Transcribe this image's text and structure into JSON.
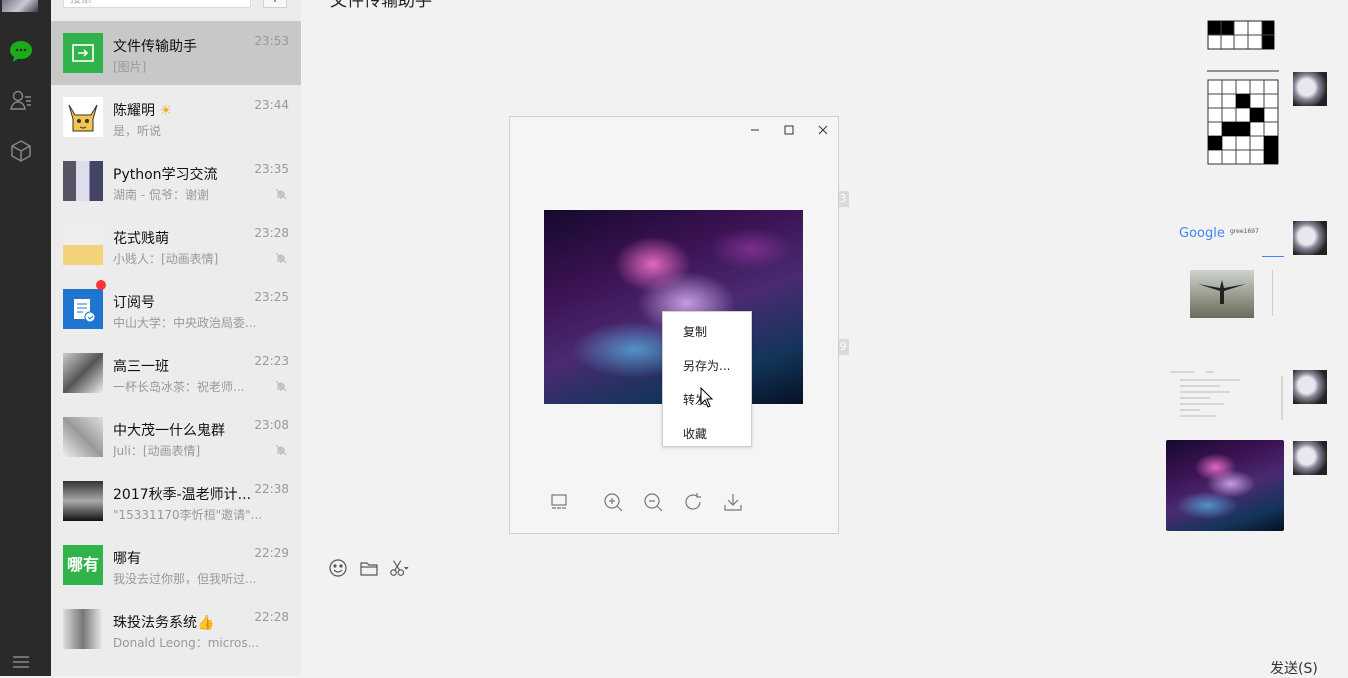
{
  "window": {
    "title": "文件传输助手"
  },
  "search": {
    "placeholder": "搜索"
  },
  "chats": [
    {
      "name": "文件传输助手",
      "time": "23:53",
      "message": "[图片]",
      "muted": false,
      "active": true
    },
    {
      "name": "陈耀明",
      "time": "23:44",
      "message": "是，听说",
      "muted": false
    },
    {
      "name": "Python学习交流",
      "time": "23:35",
      "message": "湖南 - 侃爷：谢谢",
      "muted": true
    },
    {
      "name": "花式贱萌",
      "time": "23:28",
      "message": "小贱人：[动画表情]",
      "muted": true
    },
    {
      "name": "订阅号",
      "time": "23:25",
      "message": "中山大学：中央政治局委...",
      "muted": false,
      "badge": true
    },
    {
      "name": "高三一班",
      "time": "22:23",
      "message": "一杯长岛冰茶：祝老师...",
      "muted": true
    },
    {
      "name": "中大茂一什么鬼群",
      "time": "23:08",
      "message": "Juli：[动画表情]",
      "muted": true
    },
    {
      "name": "2017秋季-温老师计...",
      "time": "22:38",
      "message": "\"15331170李忻桓\"邀请\"...",
      "muted": false
    },
    {
      "name": "哪有",
      "time": "22:29",
      "message": "我没去过你那，但我听过...",
      "muted": false
    },
    {
      "name": "珠投法务系统",
      "time": "22:28",
      "message": "Donald Leong：micros...",
      "muted": false
    }
  ],
  "icons": {
    "avatar_wenhao": "哪有"
  },
  "context_menu": [
    "复制",
    "另存为...",
    "转发",
    "收藏"
  ],
  "timestamps": [
    "3",
    "9"
  ],
  "send_button": "发送(S)",
  "google_thumb": {
    "logo": "Google",
    "query": "gree1697"
  }
}
